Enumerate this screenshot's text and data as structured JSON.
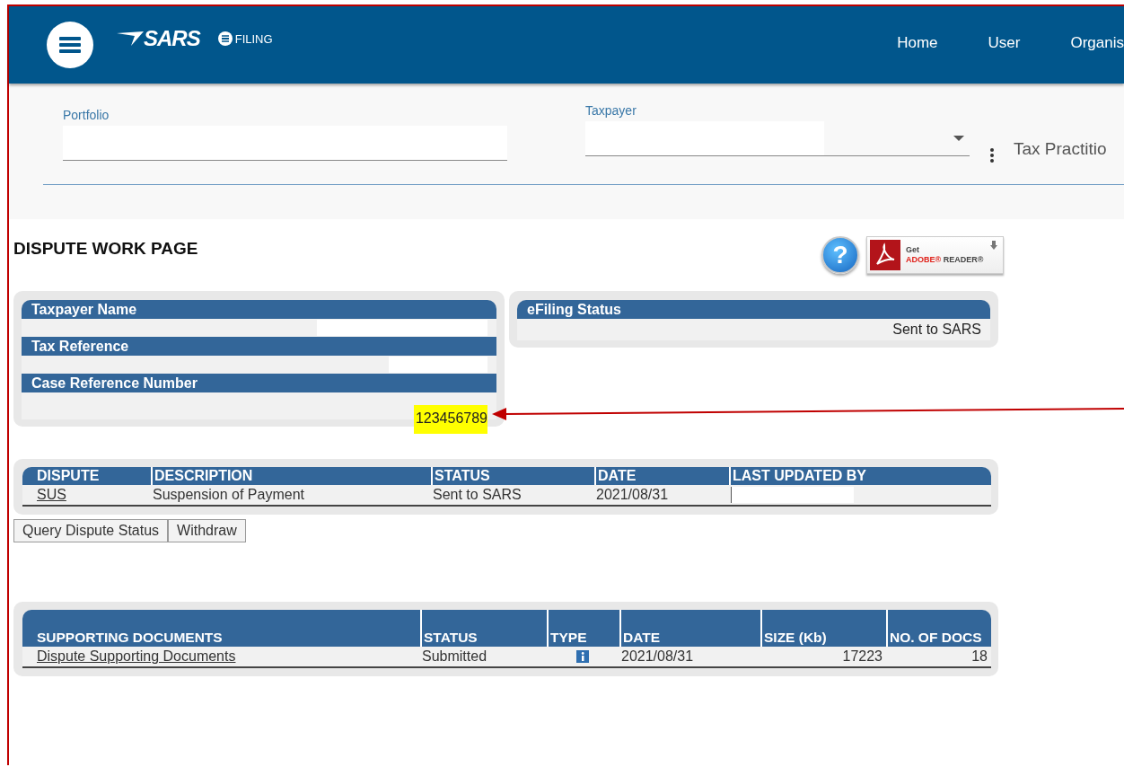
{
  "header": {
    "logo": {
      "brand": "SARS",
      "product": "FILING"
    },
    "nav": [
      "Home",
      "User",
      "Organis"
    ]
  },
  "filters": {
    "fields": [
      {
        "label": "Portfolio",
        "kind": "text"
      },
      {
        "label": "Taxpayer",
        "kind": "dropdown"
      }
    ],
    "role": "Tax Practitio"
  },
  "page_title": "DISPUTE WORK PAGE",
  "help_button": {
    "glyph": "?"
  },
  "adobe_badge": {
    "line_1": "Get",
    "brand": "ADOBE®",
    "product": "READER®"
  },
  "details_panel": {
    "fields": [
      {
        "label": "Taxpayer Name",
        "redacted": true
      },
      {
        "label": "Tax Reference",
        "redacted": true
      },
      {
        "label": "Case Reference Number",
        "value": "123456789",
        "highlighted": true
      }
    ]
  },
  "status_panel": {
    "fields": [
      {
        "label": "eFiling Status",
        "value": "Sent to SARS"
      }
    ]
  },
  "dispute_table": {
    "columns": [
      "DISPUTE",
      "DESCRIPTION",
      "STATUS",
      "DATE",
      "LAST UPDATED BY"
    ],
    "rows": [
      {
        "cells": [
          {
            "kind": "link",
            "text": "SUS"
          },
          {
            "kind": "text",
            "text": "Suspension of Payment"
          },
          {
            "kind": "text",
            "text": "Sent to SARS"
          },
          {
            "kind": "text",
            "text": "2021/08/31"
          },
          {
            "kind": "redacted"
          }
        ]
      }
    ]
  },
  "dispute_buttons": [
    "Query Dispute Status",
    "Withdraw"
  ],
  "documents_table": {
    "columns": [
      "SUPPORTING DOCUMENTS",
      "STATUS",
      "TYPE",
      "DATE",
      "SIZE (Kb)",
      "NO. OF DOCS"
    ],
    "rows": [
      {
        "cells": [
          {
            "kind": "link",
            "text": "Dispute Supporting Documents"
          },
          {
            "kind": "text",
            "text": "Submitted"
          },
          {
            "kind": "icon"
          },
          {
            "kind": "text",
            "text": "2021/08/31"
          },
          {
            "kind": "number",
            "text": "17223"
          },
          {
            "kind": "number",
            "text": "18"
          }
        ]
      }
    ]
  },
  "annotation": {
    "kind": "arrow"
  }
}
